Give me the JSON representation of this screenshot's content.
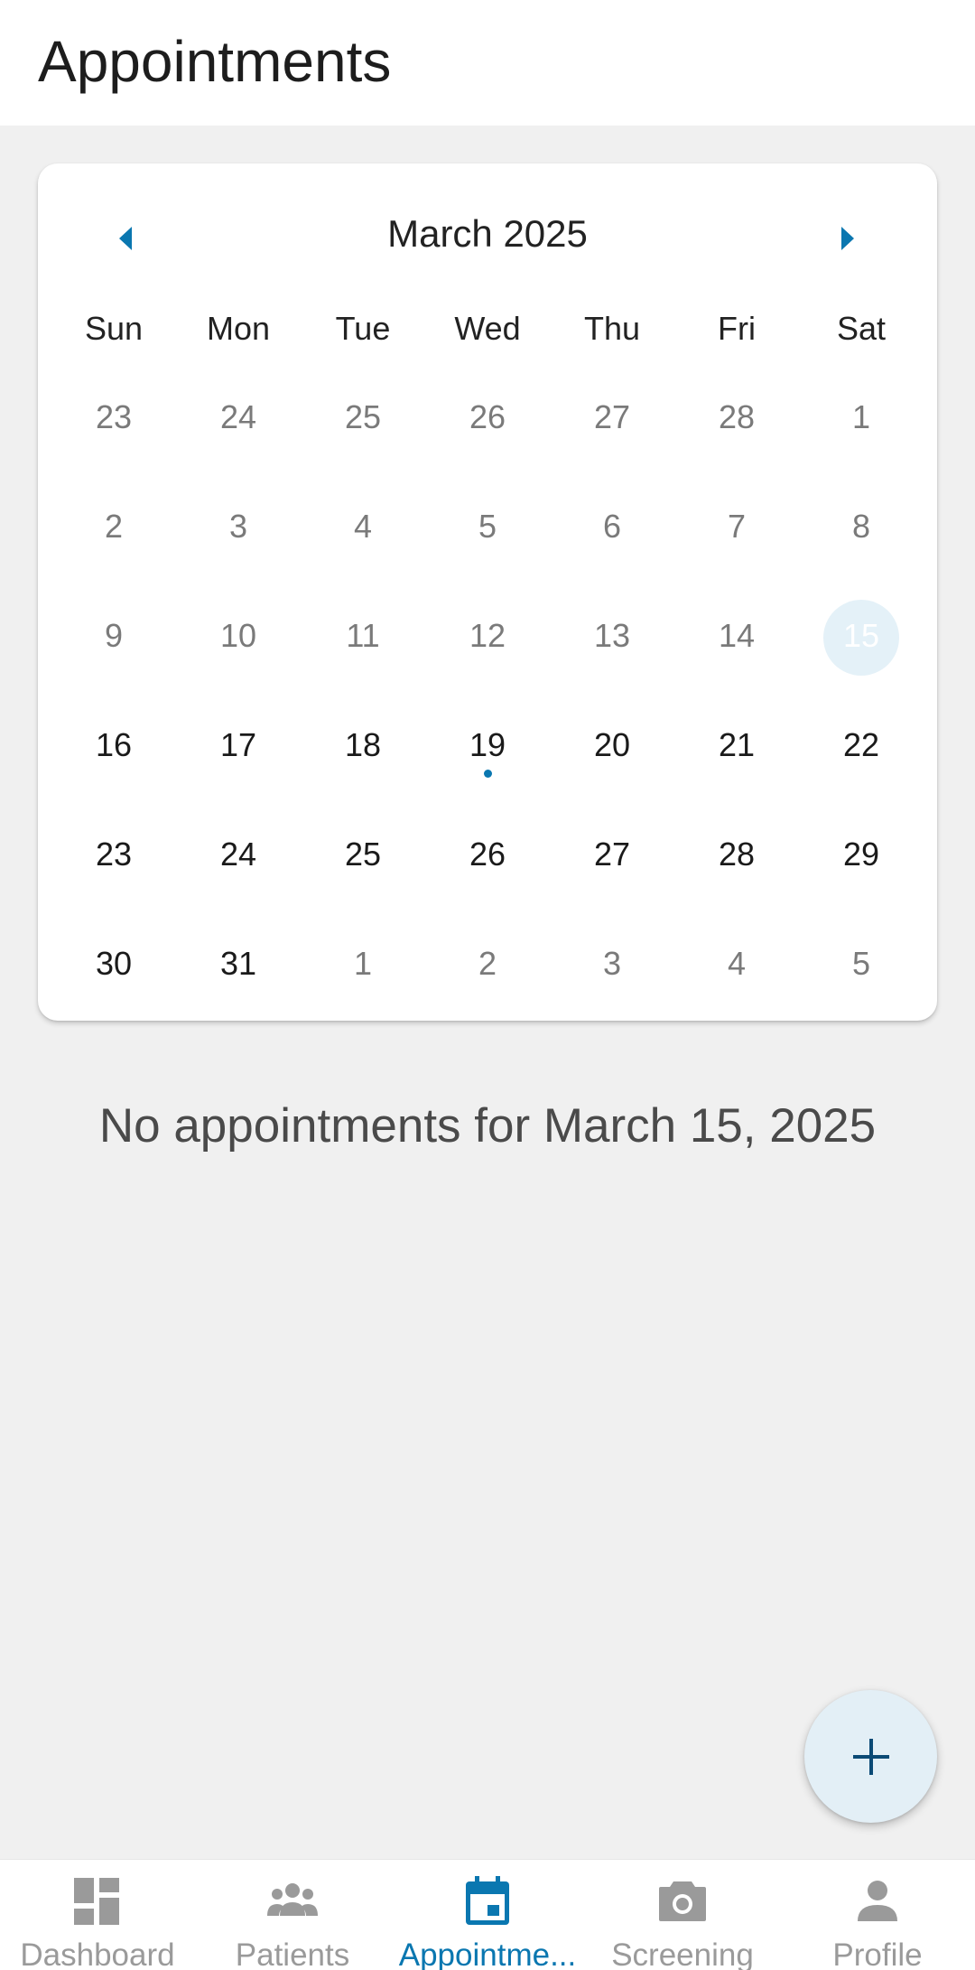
{
  "header": {
    "title": "Appointments"
  },
  "calendar": {
    "month_label": "March 2025",
    "weekdays": [
      "Sun",
      "Mon",
      "Tue",
      "Wed",
      "Thu",
      "Fri",
      "Sat"
    ],
    "weeks": [
      [
        "23",
        "24",
        "25",
        "26",
        "27",
        "28",
        "1"
      ],
      [
        "2",
        "3",
        "4",
        "5",
        "6",
        "7",
        "8"
      ],
      [
        "9",
        "10",
        "11",
        "12",
        "13",
        "14",
        "15"
      ],
      [
        "16",
        "17",
        "18",
        "19",
        "20",
        "21",
        "22"
      ],
      [
        "23",
        "24",
        "25",
        "26",
        "27",
        "28",
        "29"
      ],
      [
        "30",
        "31",
        "1",
        "2",
        "3",
        "4",
        "5"
      ]
    ],
    "selected_date": "15",
    "has_appointment_date": "19"
  },
  "empty_message": "No appointments for March 15, 2025",
  "fab": {
    "icon": "plus-icon"
  },
  "bottom_nav": {
    "items": [
      {
        "label": "Dashboard",
        "icon": "dashboard-icon"
      },
      {
        "label": "Patients",
        "icon": "patients-icon"
      },
      {
        "label": "Appointme...",
        "icon": "calendar-icon"
      },
      {
        "label": "Screening",
        "icon": "camera-icon"
      },
      {
        "label": "Profile",
        "icon": "person-icon"
      }
    ],
    "active": "Appointme..."
  },
  "colors": {
    "accent": "#0a77b0",
    "selected_bg": "#e4f1f8",
    "fab_bg": "#e3eff6",
    "page_bg": "#f0f0f0",
    "inactive": "#9a9a9a"
  }
}
